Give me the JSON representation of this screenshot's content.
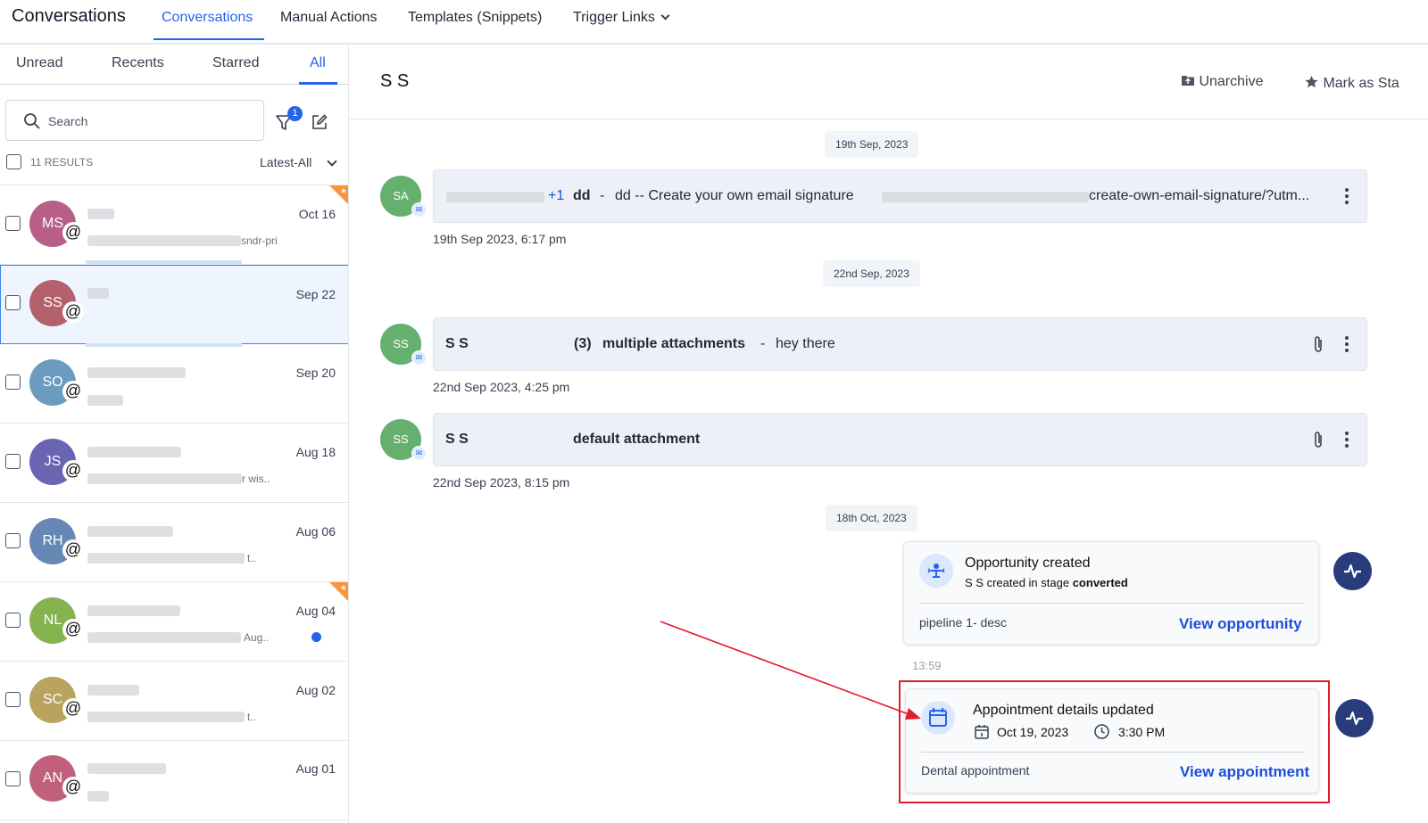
{
  "topbar": {
    "title": "Conversations",
    "tabs": [
      "Conversations",
      "Manual Actions",
      "Templates (Snippets)",
      "Trigger Links"
    ]
  },
  "filters": {
    "tabs": [
      "Unread",
      "Recents",
      "Starred",
      "All"
    ],
    "active": "All"
  },
  "search": {
    "placeholder": "Search",
    "filter_count": "1"
  },
  "results": {
    "count_label": "11 RESULTS",
    "sort_label": "Latest-All"
  },
  "conversations": [
    {
      "initials": "MS",
      "date": "Oct 16",
      "preview_tail": "sndr-pri",
      "color": "#b85f89",
      "starred": true
    },
    {
      "initials": "SS",
      "date": "Sep 22",
      "preview_tail": "",
      "color": "#b4616b",
      "selected": true
    },
    {
      "initials": "SO",
      "date": "Sep 20",
      "preview_tail": "",
      "color": "#6b9cc0"
    },
    {
      "initials": "JS",
      "date": "Aug 18",
      "preview_tail": "r wis..",
      "color": "#6a65b3"
    },
    {
      "initials": "RH",
      "date": "Aug 06",
      "preview_tail": "t..",
      "color": "#6688b7"
    },
    {
      "initials": "NL",
      "date": "Aug 04",
      "preview_tail": "Aug..",
      "color": "#85b34f",
      "starred": true,
      "unread": true
    },
    {
      "initials": "SC",
      "date": "Aug 02",
      "preview_tail": "t..",
      "color": "#b9a35e"
    },
    {
      "initials": "AN",
      "date": "Aug 01",
      "preview_tail": "",
      "color": "#c0607d"
    }
  ],
  "header": {
    "contact_name": "S S",
    "unarchive": "Unarchive",
    "mark_starred": "Mark as Sta"
  },
  "timeline": {
    "date1": "19th Sep, 2023",
    "msg1": {
      "avatar": "SA",
      "plus": "+1",
      "subject": "dd",
      "sep": "-",
      "body": "dd -- Create your own email signature",
      "link_tail": "create-own-email-signature/?utm...",
      "time": "19th Sep 2023, 6:17 pm"
    },
    "date2": "22nd Sep, 2023",
    "msg2": {
      "avatar": "SS",
      "from": "S S",
      "count": "(3)",
      "subject": "multiple attachments",
      "sep": "-",
      "body": "hey there",
      "time": "22nd Sep 2023, 4:25 pm"
    },
    "msg3": {
      "avatar": "SS",
      "from": "S S",
      "subject": "default attachment",
      "time": "22nd Sep 2023, 8:15 pm"
    },
    "date3": "18th Oct, 2023",
    "opportunity": {
      "title": "Opportunity created",
      "sub_prefix": "S S created in stage",
      "stage": "converted",
      "pipeline": "pipeline 1- desc",
      "link": "View opportunity",
      "time": "13:59"
    },
    "appointment": {
      "title": "Appointment details updated",
      "date": "Oct 19, 2023",
      "time": "3:30 PM",
      "name": "Dental appointment",
      "link": "View appointment"
    }
  },
  "colors": {
    "accent": "#2563eb",
    "highlight": "#e11d2a",
    "activity": "#283b7b"
  }
}
